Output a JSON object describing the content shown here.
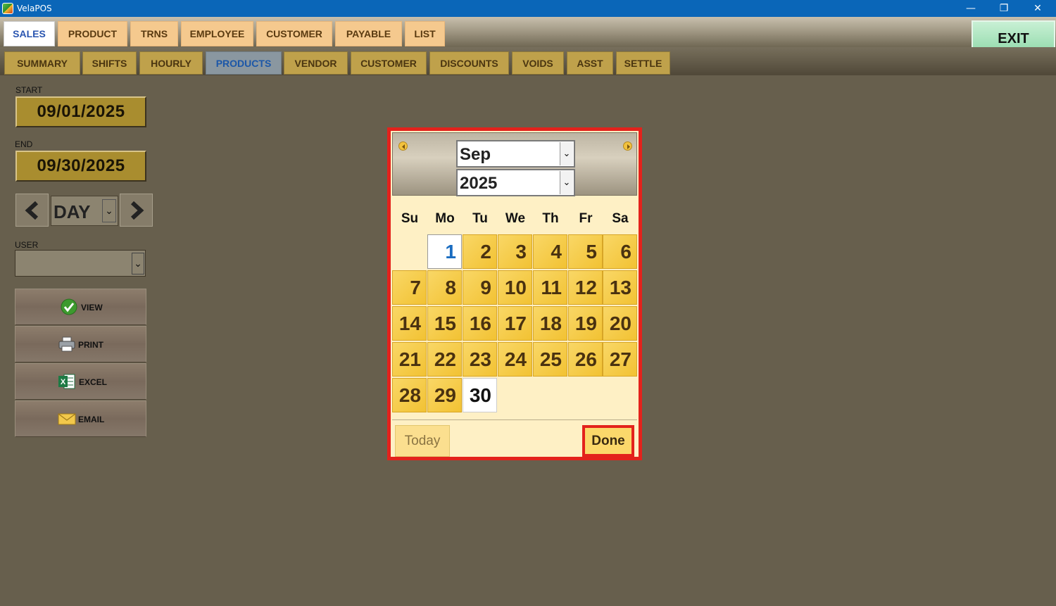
{
  "window": {
    "title": "VelaPOS",
    "minimize": "—",
    "restore": "❐",
    "close": "✕"
  },
  "top_tabs": [
    "SALES",
    "PRODUCT",
    "TRNS",
    "EMPLOYEE",
    "CUSTOMER",
    "PAYABLE",
    "LIST"
  ],
  "exit_label": "EXIT",
  "sub_tabs": [
    "SUMMARY",
    "SHIFTS",
    "HOURLY",
    "PRODUCTS",
    "VENDOR",
    "CUSTOMER",
    "DISCOUNTS",
    "VOIDS",
    "ASST",
    "SETTLE"
  ],
  "filters": {
    "start_label": "START",
    "start_value": "09/01/2025",
    "end_label": "END",
    "end_value": "09/30/2025",
    "period_value": "DAY",
    "user_label": "USER",
    "user_value": ""
  },
  "actions": {
    "view": "VIEW",
    "print": "PRINT",
    "excel": "EXCEL",
    "email": "EMAIL"
  },
  "calendar": {
    "month": "Sep",
    "year": "2025",
    "weekdays": [
      "Su",
      "Mo",
      "Tu",
      "We",
      "Th",
      "Fr",
      "Sa"
    ],
    "days": [
      "1",
      "2",
      "3",
      "4",
      "5",
      "6",
      "7",
      "8",
      "9",
      "10",
      "11",
      "12",
      "13",
      "14",
      "15",
      "16",
      "17",
      "18",
      "19",
      "20",
      "21",
      "22",
      "23",
      "24",
      "25",
      "26",
      "27",
      "28",
      "29",
      "30"
    ],
    "today_label": "Today",
    "done_label": "Done"
  },
  "colors": {
    "accent_red": "#e3221c",
    "tab_orange": "#f5c98e",
    "day_gold": "#f2c233",
    "background": "#675f4d"
  }
}
